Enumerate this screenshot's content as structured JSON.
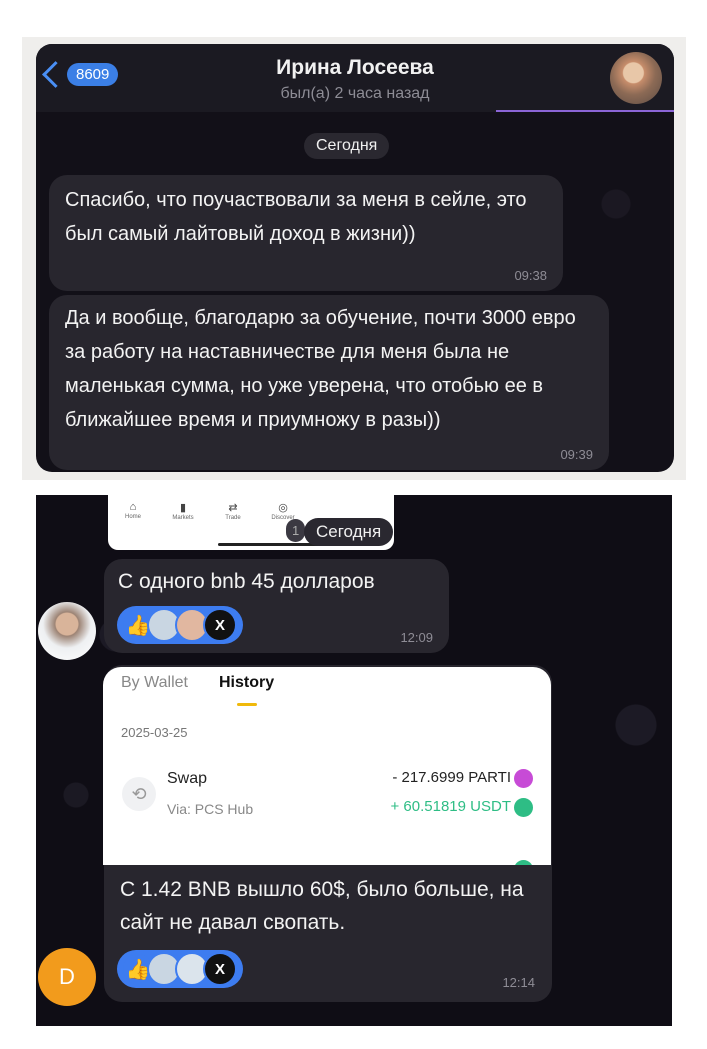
{
  "top_chat": {
    "back_badge": "8609",
    "contact_name": "Ирина Лосеева",
    "last_seen": "был(а) 2 часа назад",
    "date_chip": "Сегодня",
    "messages": [
      {
        "text": "Спасибо, что поучаствовали за меня в сейле, это был самый лайтовый доход в жизни))",
        "time": "09:38"
      },
      {
        "text": "Да и вообще, благодарю за обучение, почти 3000 евро за работу на наставничестве для меня была не маленькая сумма, но уже уверена, что отобью ее в ближайшее время и приумножу в разы))",
        "time": "09:39"
      }
    ]
  },
  "bottom_chat": {
    "nav": {
      "home": "Home",
      "markets": "Markets",
      "trade": "Trade",
      "discover": "Discover"
    },
    "nav_partial_number": "1",
    "date_chip": "Сегодня",
    "message1": {
      "text": "С одного bnb 45 долларов",
      "time": "12:09"
    },
    "card": {
      "tab_wallet": "By Wallet",
      "tab_history": "History",
      "date": "2025-03-25",
      "row_title": "Swap",
      "row_via": "Via: PCS Hub",
      "amount_out": "- 217.6999 PARTI",
      "amount_in": "+ 60.51819 USDT"
    },
    "message2": {
      "text": "С 1.42 BNB вышло 60$, было больше, на сайт не давал свопать.",
      "time": "12:14"
    },
    "avatar_letter": "D",
    "reaction_x": "X",
    "colors": {
      "accent": "#3d7cf0",
      "bubble": "#28262e",
      "positive": "#2ebd85",
      "binance_yellow": "#f0b90b"
    }
  }
}
